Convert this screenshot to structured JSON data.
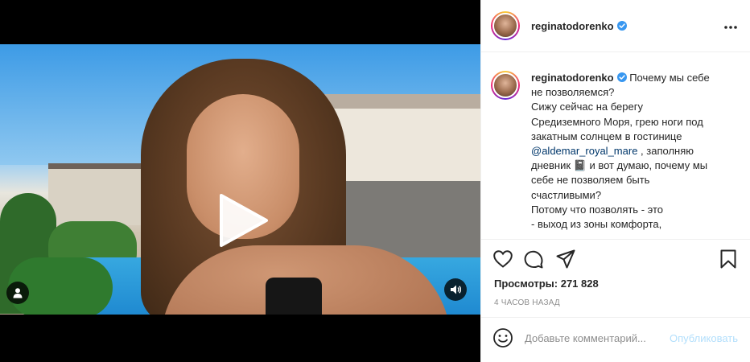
{
  "post": {
    "username": "reginatodorenko",
    "caption_lines": [
      "Почему мы себе",
      "не позволяемся?",
      "Сижу сейчас на берегу",
      "Средиземного Моря, грею ноги под",
      "закатным солнцем в гостинице",
      "@aldemar_royal_mare",
      ", заполняю",
      "дневник 📓 и вот думаю, почему мы",
      "себе не позволяем быть",
      "счастливыми?",
      "Потому что позволять - это",
      "- выход из зоны комфорта,"
    ],
    "views_label": "Просмотры:",
    "views_count": "271 828",
    "time": "4 ЧАСОВ НАЗАД",
    "comment_placeholder": "Добавьте комментарий...",
    "publish_label": "Опубликовать"
  },
  "icons": {
    "more": "more-options-icon",
    "like": "heart-icon",
    "comment": "comment-icon",
    "share": "share-icon",
    "save": "bookmark-icon",
    "emoji": "emoji-icon",
    "play": "play-icon",
    "user": "tagged-user-icon",
    "sound": "sound-icon",
    "verified": "verified-badge-icon"
  },
  "colors": {
    "verified": "#3897f0",
    "mention": "#00376b",
    "publish_disabled": "#b2dffc"
  }
}
